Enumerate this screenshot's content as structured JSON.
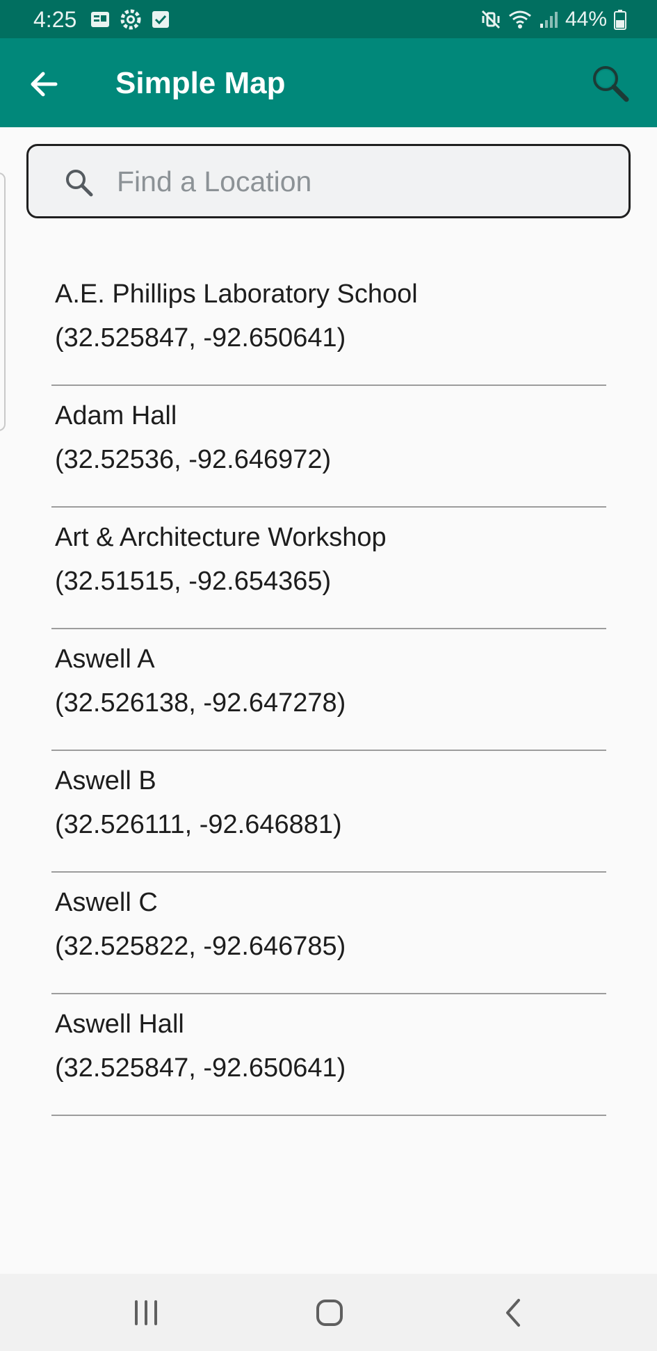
{
  "status_bar": {
    "time": "4:25",
    "battery_percent": "44%",
    "left_icons": [
      "gallery-icon",
      "settings-gear-icon",
      "checkbox-icon"
    ],
    "right_icons": [
      "mute-vibrate-icon",
      "wifi-icon",
      "signal-icon",
      "battery-icon"
    ]
  },
  "app_bar": {
    "title": "Simple Map",
    "back_icon": "arrow-left-icon",
    "search_icon": "magnifier-icon"
  },
  "search": {
    "placeholder": "Find a Location",
    "value": ""
  },
  "locations": [
    {
      "name": "A.E. Phillips Laboratory School",
      "coords": "(32.525847, -92.650641)"
    },
    {
      "name": "Adam Hall",
      "coords": "(32.52536, -92.646972)"
    },
    {
      "name": "Art & Architecture Workshop",
      "coords": "(32.51515, -92.654365)"
    },
    {
      "name": "Aswell A",
      "coords": "(32.526138, -92.647278)"
    },
    {
      "name": "Aswell B",
      "coords": "(32.526111, -92.646881)"
    },
    {
      "name": "Aswell C",
      "coords": "(32.525822, -92.646785)"
    },
    {
      "name": "Aswell Hall",
      "coords": "(32.525847, -92.650641)"
    }
  ],
  "nav_bar": {
    "buttons": [
      "recent-apps-icon",
      "home-icon",
      "back-icon"
    ]
  },
  "colors": {
    "status_bar": "#016f60",
    "app_bar": "#01887a",
    "background": "#fafafa",
    "nav_bar": "#f1f1f1"
  }
}
